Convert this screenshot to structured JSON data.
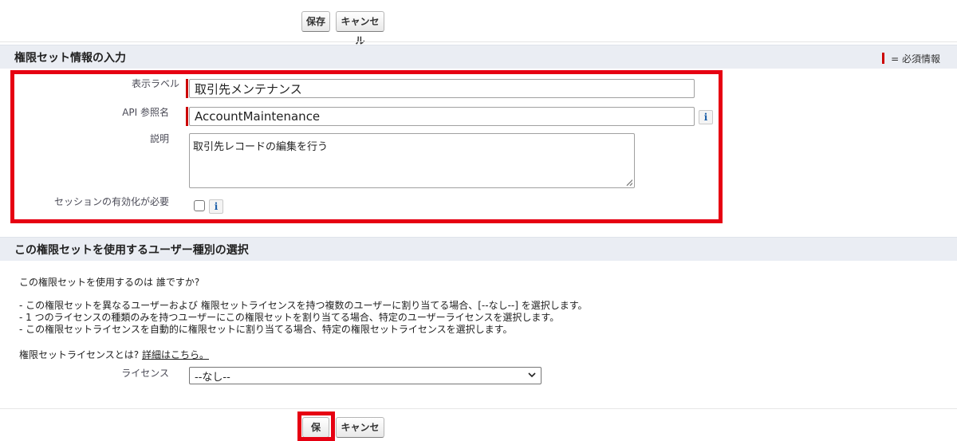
{
  "toolbar": {
    "save_label": "保存",
    "cancel_label": "キャンセル"
  },
  "section1": {
    "title": "権限セット情報の入力",
    "required_legend": "= 必須情報",
    "fields": {
      "label": {
        "label": "表示ラベル",
        "value": "取引先メンテナンス"
      },
      "api_name": {
        "label": "API 参照名",
        "value": "AccountMaintenance"
      },
      "description": {
        "label": "説明",
        "value": "取引先レコードの編集を行う"
      },
      "session": {
        "label": "セッションの有効化が必要",
        "checked": false
      }
    }
  },
  "section2": {
    "title": "この権限セットを使用するユーザー種別の選択",
    "question": "この権限セットを使用するのは 誰ですか?",
    "bullets": [
      "- この権限セットを異なるユーザーおよび 権限セットライセンスを持つ複数のユーザーに割り当てる場合、[--なし--] を選択します。",
      "- 1 つのライセンスの種類のみを持つユーザーにこの権限セットを割り当てる場合、特定のユーザーライセンスを選択します。",
      "- この権限セットライセンスを自動的に権限セットに割り当てる場合、特定の権限セットライセンスを選択します。"
    ],
    "license_question": "権限セットライセンスとは?",
    "license_link": "詳細はこちら。",
    "license_label": "ライセンス",
    "license_value": "--なし--"
  },
  "colors": {
    "required": "#cc0000",
    "highlight": "#e60012",
    "section_bg": "#eaedf3"
  },
  "icons": {
    "info": "info-icon",
    "dropdown": "chevron-down-icon"
  }
}
